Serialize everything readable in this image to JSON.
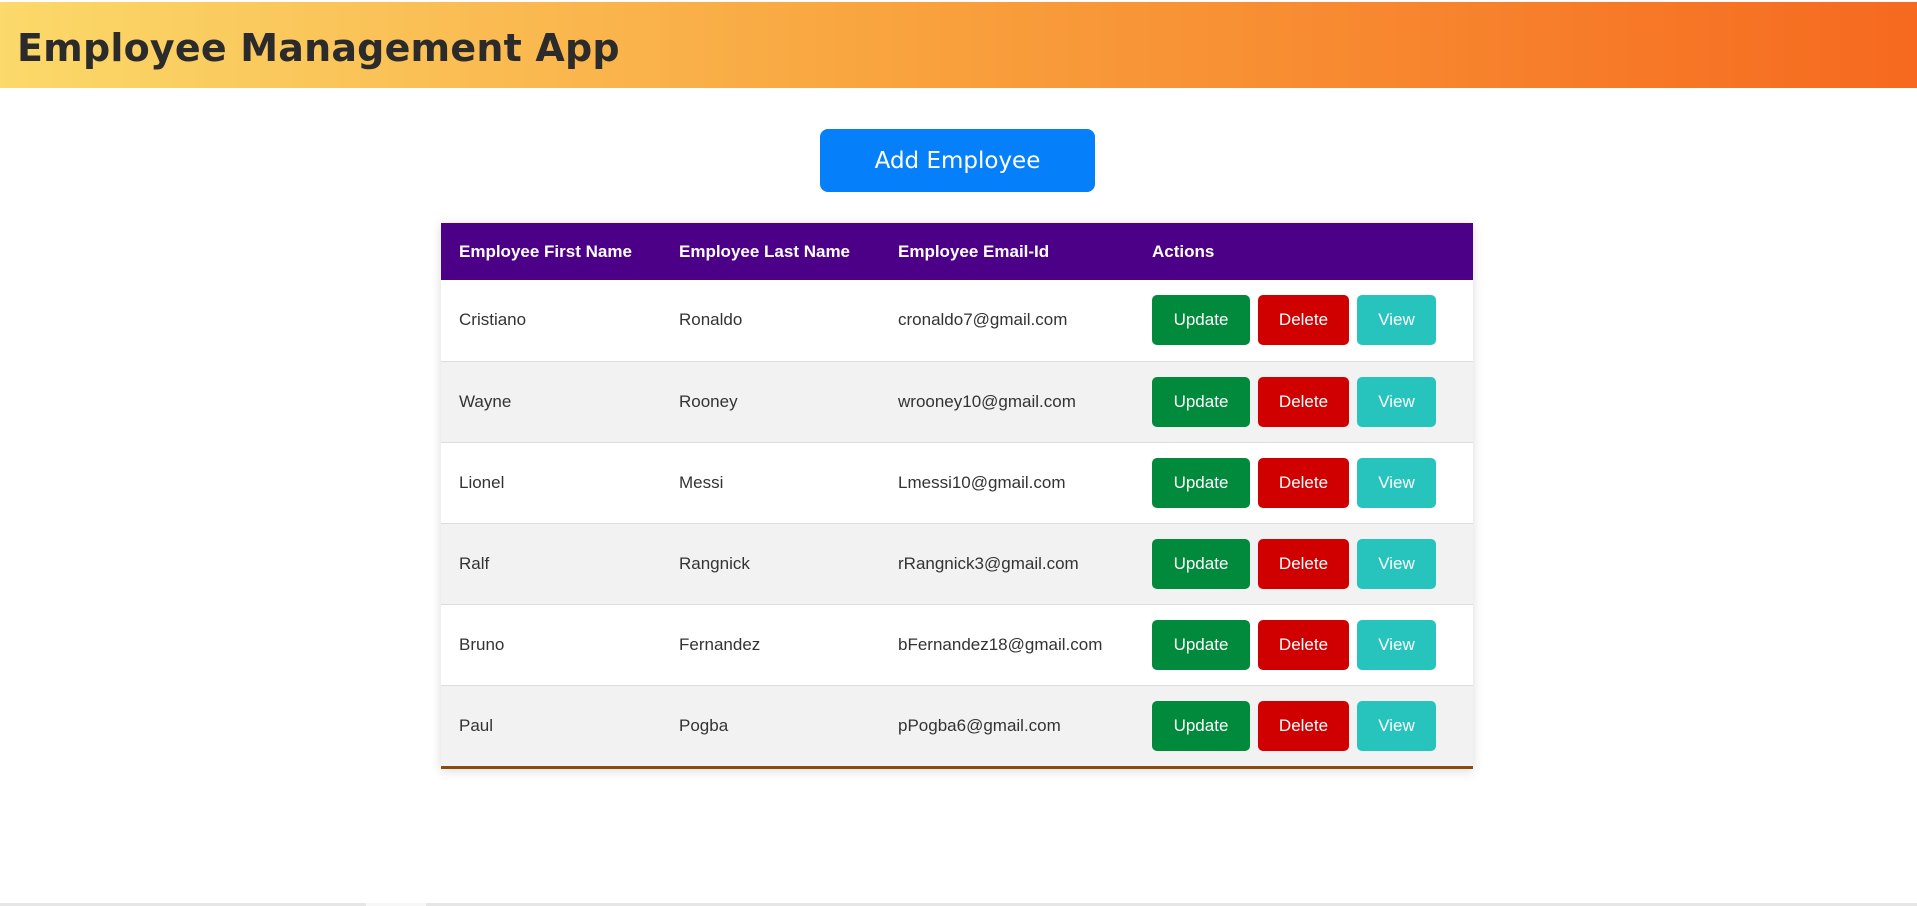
{
  "app": {
    "title": "Employee Management App"
  },
  "toolbar": {
    "add_label": "Add Employee"
  },
  "table": {
    "headers": [
      "Employee First Name",
      "Employee Last Name",
      "Employee Email-Id",
      "Actions"
    ],
    "action_labels": {
      "update": "Update",
      "delete": "Delete",
      "view": "View"
    },
    "rows": [
      {
        "first_name": "Cristiano",
        "last_name": "Ronaldo",
        "email": "cronaldo7@gmail.com"
      },
      {
        "first_name": "Wayne",
        "last_name": "Rooney",
        "email": "wrooney10@gmail.com"
      },
      {
        "first_name": "Lionel",
        "last_name": "Messi",
        "email": "Lmessi10@gmail.com"
      },
      {
        "first_name": "Ralf",
        "last_name": "Rangnick",
        "email": "rRangnick3@gmail.com"
      },
      {
        "first_name": "Bruno",
        "last_name": "Fernandez",
        "email": "bFernandez18@gmail.com"
      },
      {
        "first_name": "Paul",
        "last_name": "Pogba",
        "email": "pPogba6@gmail.com"
      }
    ]
  },
  "colors": {
    "header_gradient": [
      "#fbd96a",
      "#f6691f"
    ],
    "add_button": "#0580fa",
    "table_header": "#4b0087",
    "update_button": "#018a3c",
    "delete_button": "#d10000",
    "view_button": "#27c4bd"
  }
}
